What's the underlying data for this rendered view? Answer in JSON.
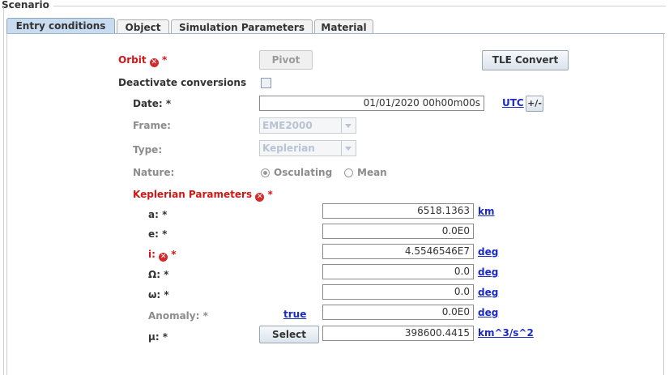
{
  "scenario_title": "Scenario",
  "tabs": [
    {
      "label": "Entry conditions"
    },
    {
      "label": "Object"
    },
    {
      "label": "Simulation Parameters"
    },
    {
      "label": "Material"
    }
  ],
  "orbit": {
    "label": "Orbit",
    "required_mark": "*",
    "pivot_label": "Pivot",
    "tle_convert_label": "TLE Convert"
  },
  "deactivate_conversions": {
    "label": "Deactivate conversions",
    "checked": false
  },
  "date": {
    "label": "Date: *",
    "value": "01/01/2020 00h00m00s",
    "utc_label": "UTC",
    "plusminus_label": "+/-"
  },
  "frame": {
    "label": "Frame:",
    "value": "EME2000"
  },
  "type": {
    "label": "Type:",
    "value": "Keplerian"
  },
  "nature": {
    "label": "Nature:",
    "options": [
      "Osculating",
      "Mean"
    ],
    "selected": "Osculating"
  },
  "keplerian": {
    "title": "Keplerian Parameters",
    "required_mark": "*",
    "a": {
      "label": "a: *",
      "value": "6518.1363",
      "unit": "km"
    },
    "e": {
      "label": "e: *",
      "value": "0.0E0"
    },
    "i": {
      "label": "i:",
      "required_mark": "*",
      "value": "4.5546546E7",
      "unit": "deg"
    },
    "raan": {
      "label": "Ω: *",
      "value": "0.0",
      "unit": "deg"
    },
    "argp": {
      "label": "ω: *",
      "value": "0.0",
      "unit": "deg"
    },
    "anomaly": {
      "label": "Anomaly: *",
      "type_link": "true",
      "value": "0.0E0",
      "unit": "deg"
    },
    "mu": {
      "label": "μ: *",
      "select_label": "Select",
      "value": "398600.4415",
      "unit": "km^3/s^2"
    }
  },
  "colors": {
    "error": "#d12b2b",
    "link": "#1a2bc8",
    "active_tab": "#c8dcf0"
  },
  "icons": {
    "error": "error-circle-icon",
    "dropdown": "chevron-down-icon"
  }
}
